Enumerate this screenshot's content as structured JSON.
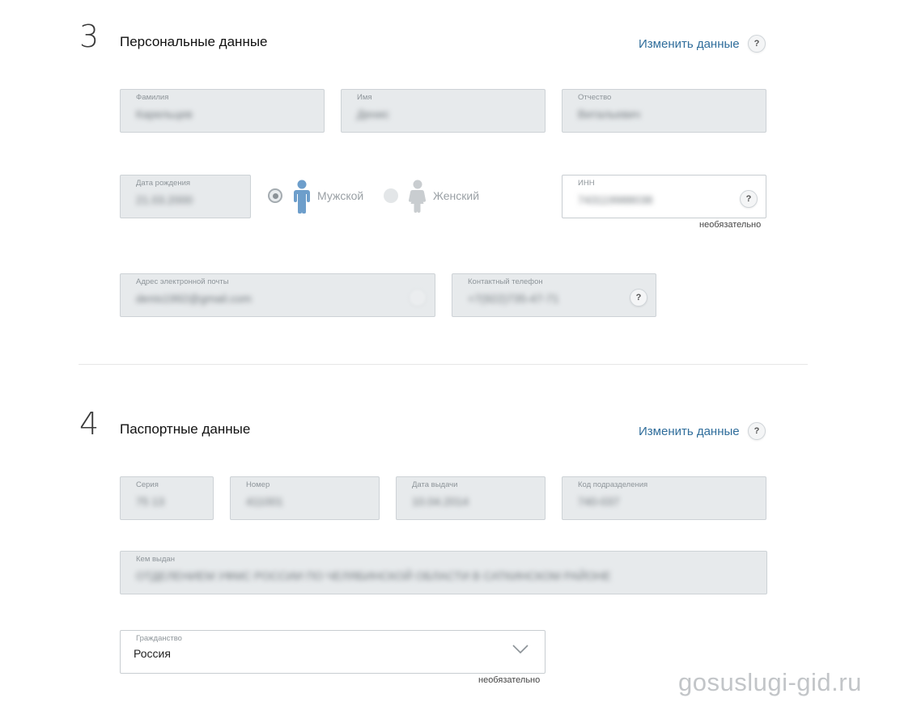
{
  "sections": {
    "personal": {
      "number": "3",
      "title": "Персональные данные",
      "change_link": "Изменить данные",
      "help": "?",
      "surname": {
        "label": "Фамилия",
        "value": "Карельцев"
      },
      "name": {
        "label": "Имя",
        "value": "Денис"
      },
      "patronymic": {
        "label": "Отчество",
        "value": "Витальевич"
      },
      "birthdate": {
        "label": "Дата рождения",
        "value": "21.03.2000"
      },
      "gender": {
        "male": "Мужской",
        "female": "Женский",
        "selected": "male"
      },
      "inn": {
        "label": "ИНН",
        "value": "743119988038",
        "help": "?",
        "note": "необязательно"
      },
      "email": {
        "label": "Адрес электронной почты",
        "value": "denis1992@gmail.com"
      },
      "phone": {
        "label": "Контактный телефон",
        "value": "+7(922)735-47-71",
        "help": "?"
      }
    },
    "passport": {
      "number": "4",
      "title": "Паспортные данные",
      "change_link": "Изменить данные",
      "help": "?",
      "series": {
        "label": "Серия",
        "value": "75 13"
      },
      "num": {
        "label": "Номер",
        "value": "411001"
      },
      "issue_date": {
        "label": "Дата выдачи",
        "value": "10.04.2014"
      },
      "dept_code": {
        "label": "Код подразделения",
        "value": "740-037"
      },
      "issued_by": {
        "label": "Кем выдан",
        "value": "ОТДЕЛЕНИЕМ УФМС РОССИИ ПО ЧЕЛЯБИНСКОЙ ОБЛАСТИ В САТКИНСКОМ РАЙОНЕ"
      },
      "citizenship": {
        "label": "Гражданство",
        "value": "Россия",
        "note": "необязательно"
      }
    }
  },
  "watermark": "gosuslugi-gid.ru",
  "colors": {
    "link": "#2f6d9b",
    "male_icon": "#6d9ecb",
    "female_icon": "#c9cdd0",
    "field_bg": "#e7eaec"
  }
}
